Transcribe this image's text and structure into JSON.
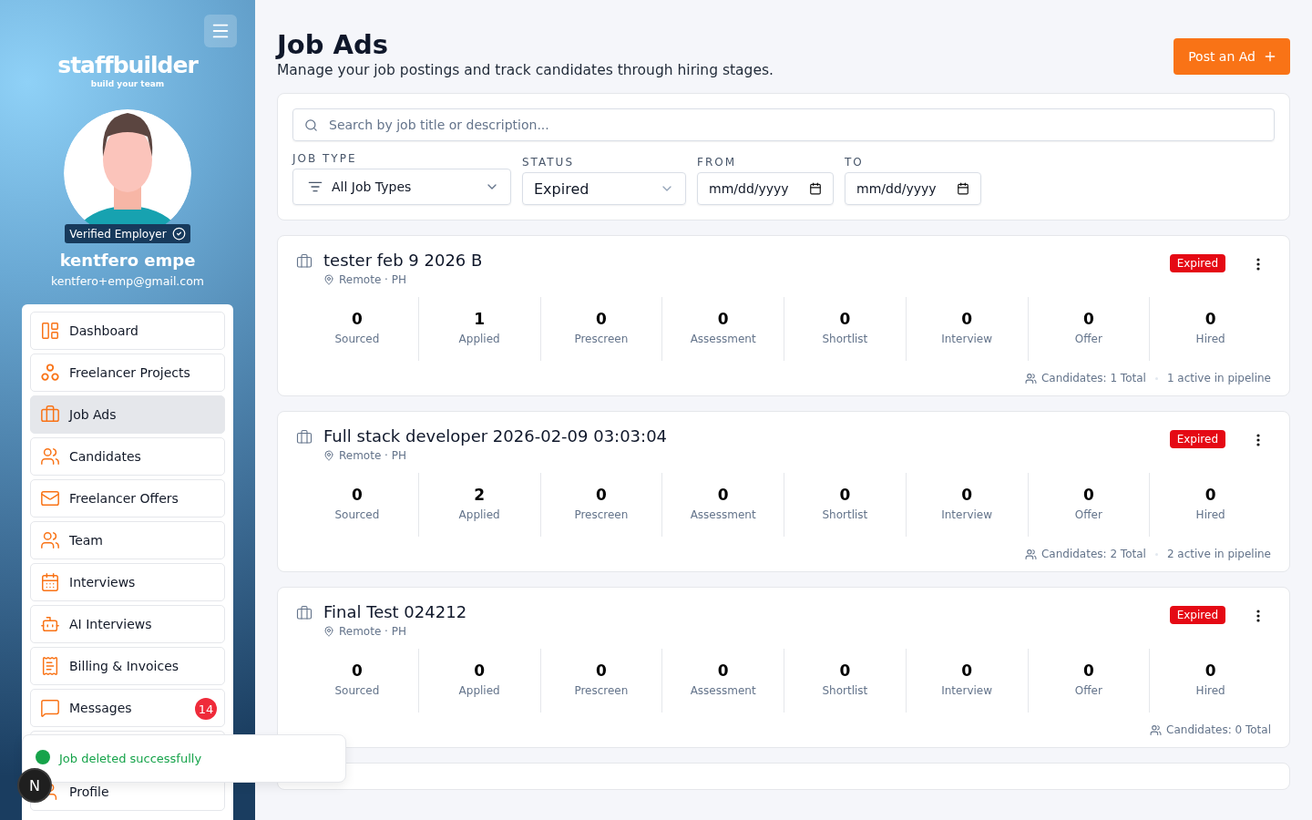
{
  "sidebar": {
    "logo": {
      "name": "staffbuilder",
      "tagline": "build your team"
    },
    "profile": {
      "badge": "Verified Employer",
      "name": "kentfero empe",
      "email": "kentfero+emp@gmail.com"
    },
    "items": [
      {
        "label": "Dashboard",
        "selected": false
      },
      {
        "label": "Freelancer Projects",
        "selected": false
      },
      {
        "label": "Job Ads",
        "selected": true
      },
      {
        "label": "Candidates",
        "selected": false
      },
      {
        "label": "Freelancer Offers",
        "selected": false
      },
      {
        "label": "Team",
        "selected": false
      },
      {
        "label": "Interviews",
        "selected": false
      },
      {
        "label": "AI Interviews",
        "selected": false
      },
      {
        "label": "Billing & Invoices",
        "selected": false
      },
      {
        "label": "Messages",
        "selected": false,
        "badge": "14"
      },
      {
        "selected": false
      },
      {
        "label": "Profile",
        "selected": false
      }
    ]
  },
  "header": {
    "title": "Job Ads",
    "subtitle": "Manage your job postings and track candidates through hiring stages.",
    "button": "Post an Ad"
  },
  "filters": {
    "search": {
      "placeholder": "Search by job title or description..."
    },
    "job_type": {
      "label": "JOB TYPE",
      "value": "All Job Types"
    },
    "status": {
      "label": "STATUS",
      "value": "Expired"
    },
    "from": {
      "label": "FROM",
      "value": "mm/dd/yyyy"
    },
    "to": {
      "label": "TO",
      "value": "mm/dd/yyyy"
    }
  },
  "jobs": [
    {
      "title": "tester feb 9 2026 B",
      "location": "Remote · PH",
      "status": "Expired",
      "stages": [
        {
          "count": "0",
          "label": "Sourced"
        },
        {
          "count": "1",
          "label": "Applied"
        },
        {
          "count": "0",
          "label": "Prescreen"
        },
        {
          "count": "0",
          "label": "Assessment"
        },
        {
          "count": "0",
          "label": "Shortlist"
        },
        {
          "count": "0",
          "label": "Interview"
        },
        {
          "count": "0",
          "label": "Offer"
        },
        {
          "count": "0",
          "label": "Hired"
        }
      ],
      "candidates": "Candidates: 1 Total",
      "active": "1 active in pipeline"
    },
    {
      "title": "Full stack developer 2026-02-09 03:03:04",
      "location": "Remote · PH",
      "status": "Expired",
      "stages": [
        {
          "count": "0",
          "label": "Sourced"
        },
        {
          "count": "2",
          "label": "Applied"
        },
        {
          "count": "0",
          "label": "Prescreen"
        },
        {
          "count": "0",
          "label": "Assessment"
        },
        {
          "count": "0",
          "label": "Shortlist"
        },
        {
          "count": "0",
          "label": "Interview"
        },
        {
          "count": "0",
          "label": "Offer"
        },
        {
          "count": "0",
          "label": "Hired"
        }
      ],
      "candidates": "Candidates: 2 Total",
      "active": "2 active in pipeline"
    },
    {
      "title": "Final Test 024212",
      "location": "Remote · PH",
      "status": "Expired",
      "stages": [
        {
          "count": "0",
          "label": "Sourced"
        },
        {
          "count": "0",
          "label": "Applied"
        },
        {
          "count": "0",
          "label": "Prescreen"
        },
        {
          "count": "0",
          "label": "Assessment"
        },
        {
          "count": "0",
          "label": "Shortlist"
        },
        {
          "count": "0",
          "label": "Interview"
        },
        {
          "count": "0",
          "label": "Offer"
        },
        {
          "count": "0",
          "label": "Hired"
        }
      ],
      "candidates": "Candidates: 0 Total"
    }
  ],
  "toast": {
    "message": "Job deleted successfully",
    "badge": "N"
  }
}
